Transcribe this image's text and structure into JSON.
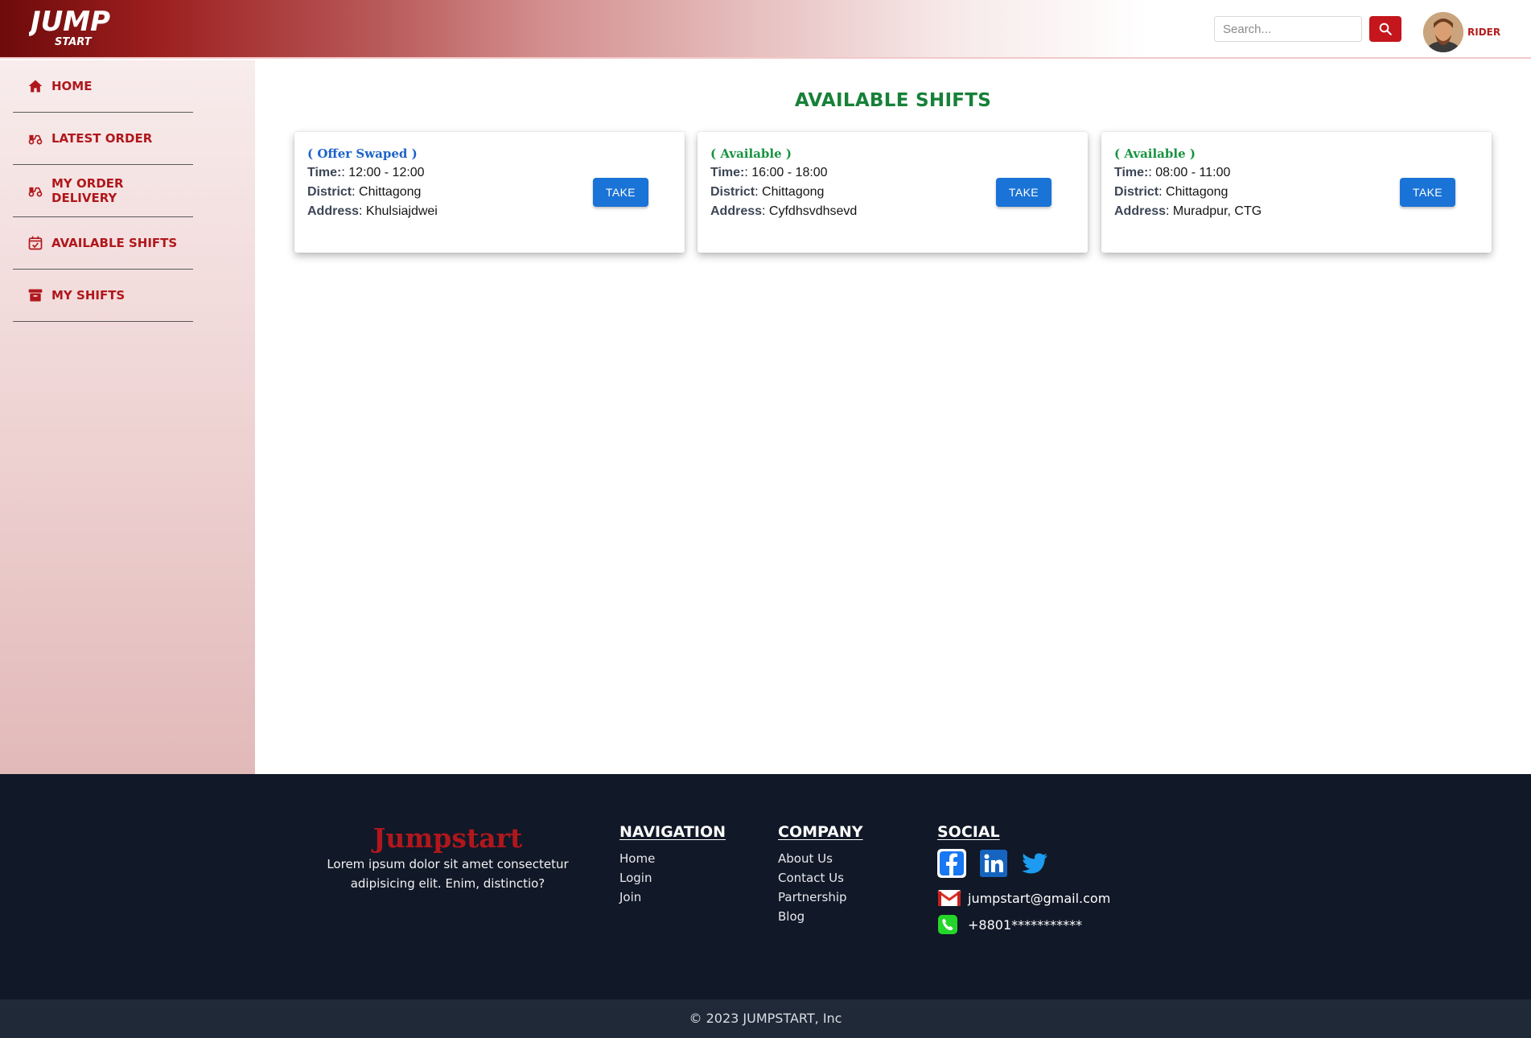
{
  "header": {
    "logo_text_top": "JUMP",
    "logo_text_bottom": "START",
    "search_placeholder": "Search...",
    "role": "RIDER"
  },
  "sidebar": {
    "items": [
      {
        "label": "HOME",
        "icon": "home-icon"
      },
      {
        "label": "LATEST ORDER",
        "icon": "scooter-icon"
      },
      {
        "label": "MY ORDER DELIVERY",
        "icon": "scooter-icon"
      },
      {
        "label": "AVAILABLE SHIFTS",
        "icon": "calendar-check-icon"
      },
      {
        "label": "MY SHIFTS",
        "icon": "archive-icon"
      }
    ]
  },
  "main": {
    "title": "AVAILABLE SHIFTS",
    "cards": [
      {
        "status": "( Offer Swaped )",
        "time_label": "Time:",
        "time": ": 12:00 - 12:00",
        "district_label": "District",
        "district": ": Chittagong",
        "address_label": "Address",
        "address": ": Khulsiajdwei",
        "button": "TAKE"
      },
      {
        "status": "( Available )",
        "time_label": "Time:",
        "time": ": 16:00 - 18:00",
        "district_label": "District",
        "district": ": Chittagong",
        "address_label": "Address",
        "address": ": Cyfdhsvdhsevd",
        "button": "TAKE"
      },
      {
        "status": "( Available )",
        "time_label": "Time:",
        "time": ": 08:00 - 11:00",
        "district_label": "District",
        "district": ": Chittagong",
        "address_label": "Address",
        "address": ": Muradpur, CTG",
        "button": "TAKE"
      }
    ]
  },
  "footer": {
    "brand": "Jumpstart",
    "description": "Lorem ipsum dolor sit amet consectetur adipisicing elit. Enim, distinctio?",
    "navigation": {
      "heading": "NAVIGATION",
      "links": [
        "Home",
        "Login",
        "Join"
      ]
    },
    "company": {
      "heading": "COMPANY",
      "links": [
        "About Us",
        "Contact Us",
        "Partnership",
        "Blog"
      ]
    },
    "social": {
      "heading": "SOCIAL",
      "email": "jumpstart@gmail.com",
      "phone": "+8801***********"
    },
    "copyright": "© 2023 JUMPSTART, Inc"
  },
  "colors": {
    "brand_red": "#b0171c",
    "title_green": "#168138",
    "button_blue": "#1a73d6",
    "footer_bg": "#111827"
  }
}
